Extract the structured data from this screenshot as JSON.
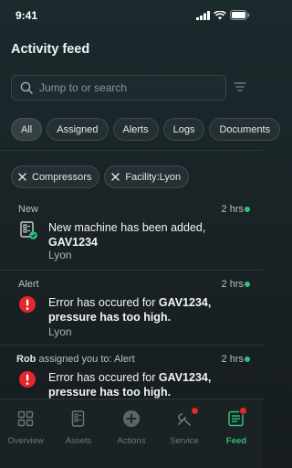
{
  "status_bar": {
    "time": "9:41"
  },
  "page": {
    "title": "Activity feed"
  },
  "search": {
    "placeholder": "Jump to or search"
  },
  "tabs": [
    {
      "label": "All",
      "active": true
    },
    {
      "label": "Assigned",
      "active": false
    },
    {
      "label": "Alerts",
      "active": false
    },
    {
      "label": "Logs",
      "active": false
    },
    {
      "label": "Documents",
      "active": false
    }
  ],
  "filters": [
    {
      "label": "Compressors"
    },
    {
      "label": "Facility:Lyon"
    }
  ],
  "feed": [
    {
      "type": "New",
      "time": "2 hrs",
      "icon": "machine-added-icon",
      "message": "New machine has been added, ",
      "message_bold": "GAV1234",
      "location": "Lyon"
    },
    {
      "type": "Alert",
      "time": "2 hrs",
      "icon": "error-icon",
      "message": "Error has occured for ",
      "message_bold": "GAV1234, pressure has too high.",
      "location": "Lyon"
    },
    {
      "assigner": "Rob",
      "assign_text": " assigned you to: Alert",
      "time": "2 hrs",
      "icon": "error-icon",
      "message": "Error has occured for ",
      "message_bold": "GAV1234, pressure has too high."
    }
  ],
  "tabbar": [
    {
      "label": "Overview",
      "icon": "overview-icon"
    },
    {
      "label": "Assets",
      "icon": "assets-icon"
    },
    {
      "label": "Actions",
      "icon": "actions-icon"
    },
    {
      "label": "Service",
      "icon": "service-icon",
      "badge": true
    },
    {
      "label": "Feed",
      "icon": "feed-icon",
      "badge": true,
      "active": true
    }
  ],
  "colors": {
    "accent": "#2bc37a",
    "error": "#e5262b",
    "background": "#1a2326"
  }
}
